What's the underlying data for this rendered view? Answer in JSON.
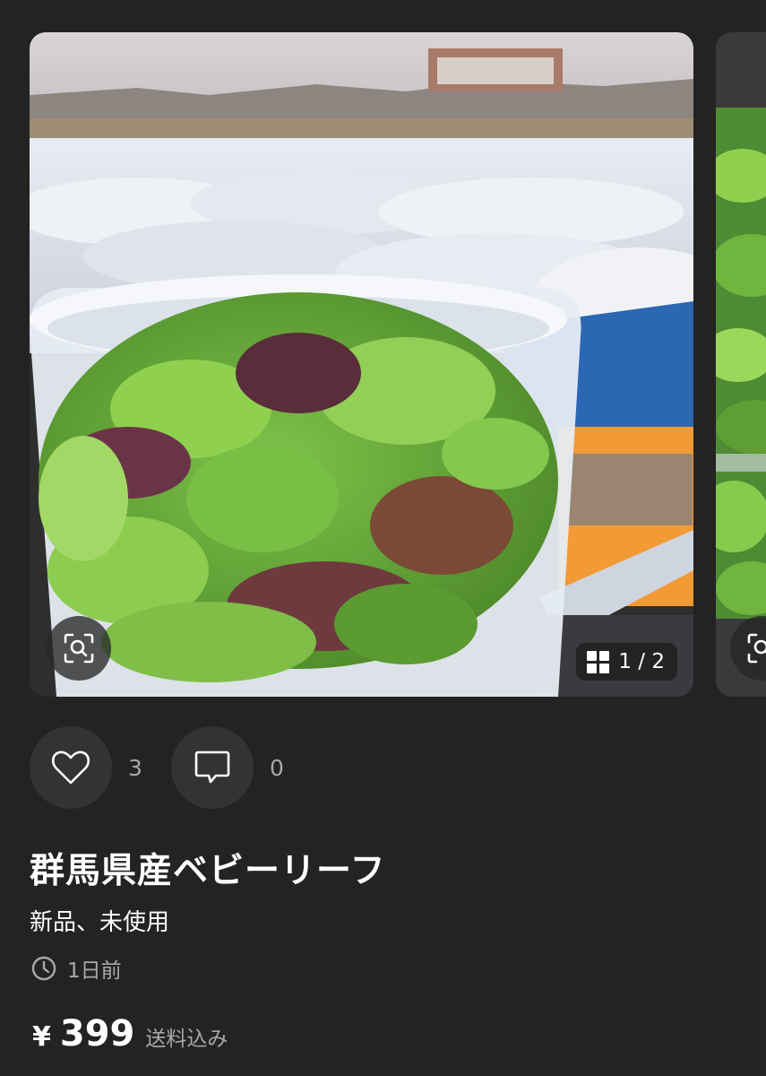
{
  "gallery": {
    "counter": "1 / 2",
    "zoom_icon": "zoom-scan-icon",
    "grid_icon": "grid-icon"
  },
  "actions": {
    "like_icon": "heart-icon",
    "like_count": "3",
    "comment_icon": "comment-icon",
    "comment_count": "0"
  },
  "item": {
    "title": "群馬県産ベビーリーフ",
    "condition": "新品、未使用",
    "posted": "1日前",
    "currency": "¥",
    "price": "399",
    "shipping": "送料込み"
  },
  "colors": {
    "background": "#232323",
    "button_bg": "#333333",
    "muted_text": "#a8a8a8"
  }
}
